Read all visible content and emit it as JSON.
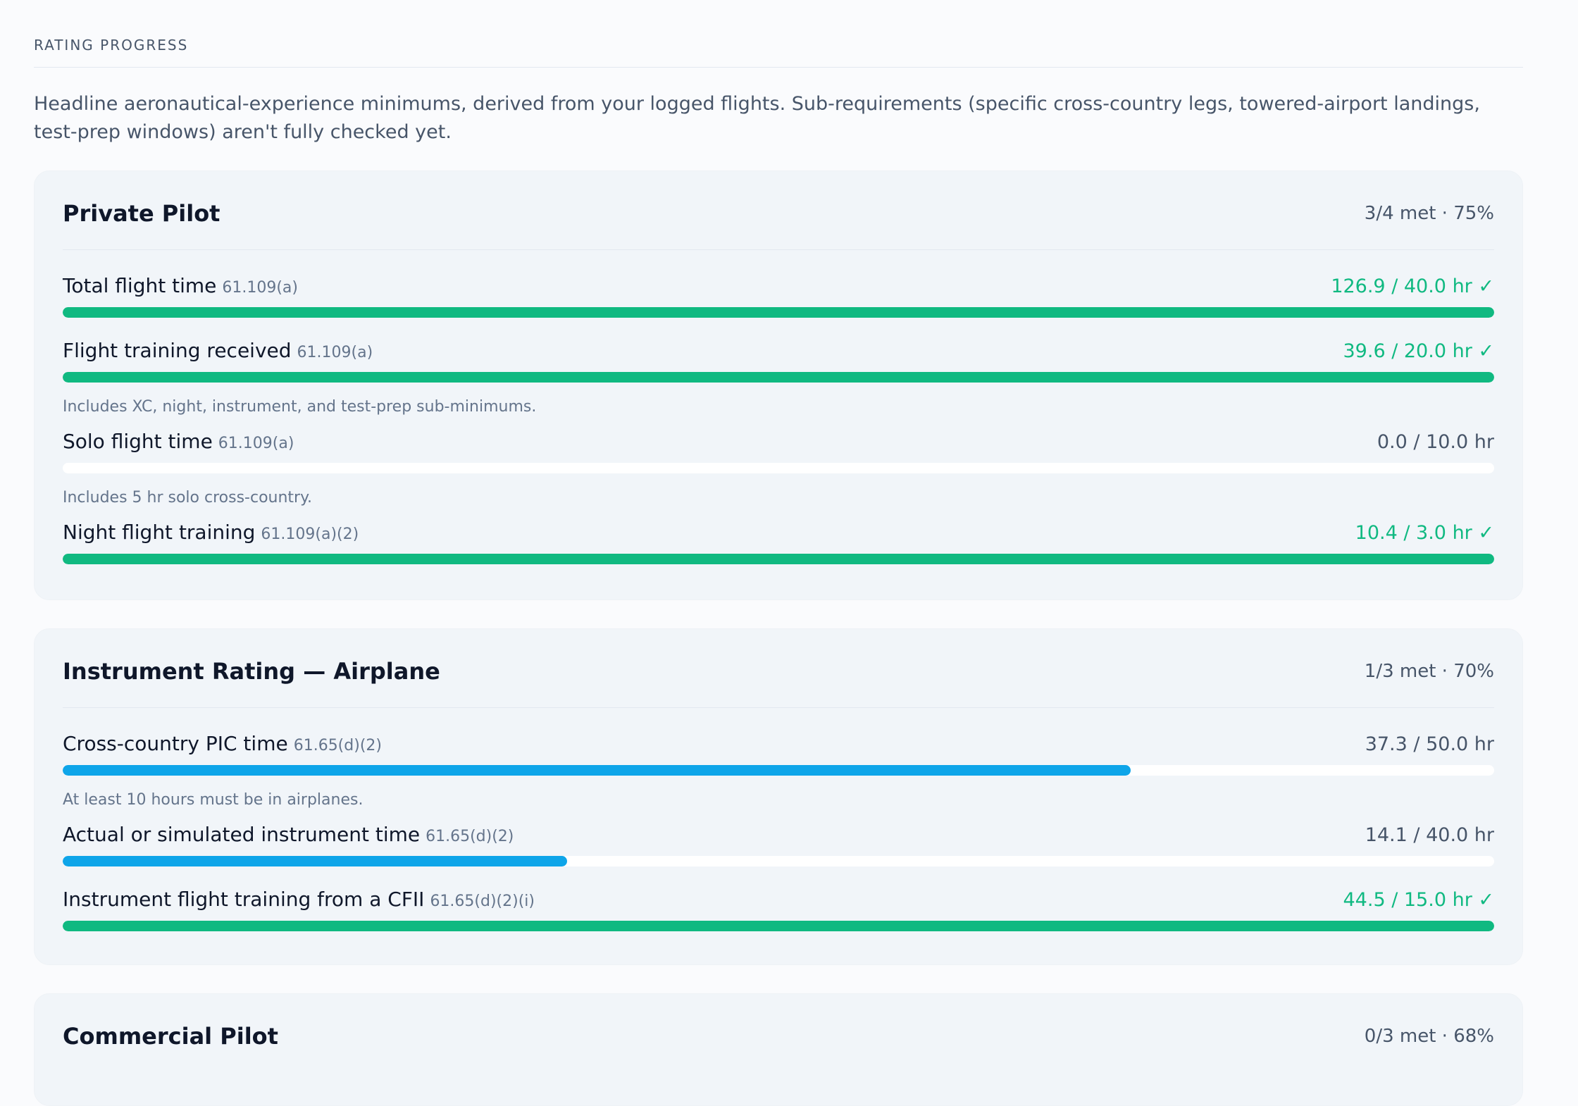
{
  "section": {
    "title": "RATING PROGRESS",
    "intro": "Headline aeronautical-experience minimums, derived from your logged flights. Sub-requirements (specific cross-country legs, towered-airport landings, test-prep windows) aren't fully checked yet."
  },
  "colors": {
    "met": "#10b981",
    "progress": "#0ea5e9",
    "track": "#ffffff",
    "card": "#f1f5f9"
  },
  "cards": [
    {
      "title": "Private Pilot",
      "summary": "3/4 met · 75%",
      "requirements": [
        {
          "label": "Total flight time",
          "ref": "61.109(a)",
          "value": "126.9 / 40.0 hr ✓",
          "met": true,
          "progress": 1.0,
          "note": ""
        },
        {
          "label": "Flight training received",
          "ref": "61.109(a)",
          "value": "39.6 / 20.0 hr ✓",
          "met": true,
          "progress": 1.0,
          "note": "Includes XC, night, instrument, and test-prep sub-minimums."
        },
        {
          "label": "Solo flight time",
          "ref": "61.109(a)",
          "value": "0.0 / 10.0 hr",
          "met": false,
          "progress": 0.0,
          "note": "Includes 5 hr solo cross-country."
        },
        {
          "label": "Night flight training",
          "ref": "61.109(a)(2)",
          "value": "10.4 / 3.0 hr ✓",
          "met": true,
          "progress": 1.0,
          "note": ""
        }
      ]
    },
    {
      "title": "Instrument Rating — Airplane",
      "summary": "1/3 met · 70%",
      "requirements": [
        {
          "label": "Cross-country PIC time",
          "ref": "61.65(d)(2)",
          "value": "37.3 / 50.0 hr",
          "met": false,
          "progress": 0.746,
          "note": "At least 10 hours must be in airplanes."
        },
        {
          "label": "Actual or simulated instrument time",
          "ref": "61.65(d)(2)",
          "value": "14.1 / 40.0 hr",
          "met": false,
          "progress": 0.3525,
          "note": ""
        },
        {
          "label": "Instrument flight training from a CFII",
          "ref": "61.65(d)(2)(i)",
          "value": "44.5 / 15.0 hr ✓",
          "met": true,
          "progress": 1.0,
          "note": ""
        }
      ]
    },
    {
      "title": "Commercial Pilot",
      "summary": "0/3 met · 68%",
      "requirements": []
    }
  ]
}
